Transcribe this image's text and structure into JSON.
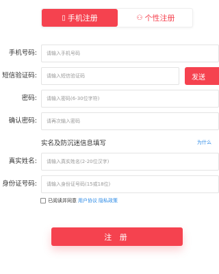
{
  "tabs": {
    "mobile": {
      "icon": "mobile-phone-icon",
      "label": "手机注册",
      "icon_glyph": "▯"
    },
    "personal": {
      "icon": "personal-icon",
      "label": "个性注册",
      "icon_glyph": "⚇"
    }
  },
  "form": {
    "phone": {
      "label": "手机号码:",
      "placeholder": "请输入手机号码"
    },
    "sms": {
      "label": "短信验证码:",
      "placeholder": "请输入短信验证码",
      "button": "发送"
    },
    "password": {
      "label": "密码:",
      "placeholder": "请输入密码(6-30位字符)"
    },
    "confirm": {
      "label": "确认密码:",
      "placeholder": "请再次输入密码"
    },
    "section_title": "实名及防沉迷信息填写",
    "why_link": "为什么",
    "realname": {
      "label": "真实姓名:",
      "placeholder": "请输入真实姓名(2-20位汉字)"
    },
    "idcard": {
      "label": "身份证号码:",
      "placeholder": "请输入身份证号码(15或18位)"
    },
    "agreement": {
      "text": "已阅读并同意",
      "user_agreement": "用户协议",
      "privacy_policy": "隐私政策"
    },
    "submit": "注 册"
  },
  "colors": {
    "accent": "#f5424f",
    "link": "#2b8ae6"
  }
}
